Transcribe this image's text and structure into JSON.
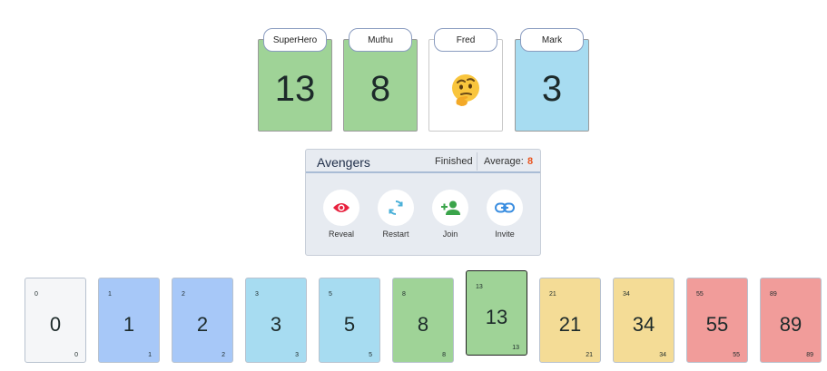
{
  "players": [
    {
      "name": "SuperHero",
      "value": "13",
      "color": "#9fd397"
    },
    {
      "name": "Muthu",
      "value": "8",
      "color": "#9fd397"
    },
    {
      "name": "Fred",
      "value": "",
      "status": "thinking-face-emoji",
      "color": "#ffffff"
    },
    {
      "name": "Mark",
      "value": "3",
      "color": "#a7dcf1"
    }
  ],
  "panel": {
    "title": "Avengers",
    "status": "Finished",
    "average_label": "Average:",
    "average_value": "8",
    "actions": [
      {
        "label": "Reveal",
        "icon": "eye-icon",
        "color": "#e8213e"
      },
      {
        "label": "Restart",
        "icon": "restart-icon",
        "color": "#4ab0d8"
      },
      {
        "label": "Join",
        "icon": "add-user-icon",
        "color": "#3aa44a"
      },
      {
        "label": "Invite",
        "icon": "link-icon",
        "color": "#3b8ee0"
      }
    ]
  },
  "deck": {
    "selected": "13",
    "cards": [
      {
        "value": "0",
        "color": "#f5f6f8"
      },
      {
        "value": "1",
        "color": "#a7c8f8"
      },
      {
        "value": "2",
        "color": "#a7c8f8"
      },
      {
        "value": "3",
        "color": "#a7dcf1"
      },
      {
        "value": "5",
        "color": "#a7dcf1"
      },
      {
        "value": "8",
        "color": "#9fd397"
      },
      {
        "value": "13",
        "color": "#9fd397"
      },
      {
        "value": "21",
        "color": "#f4dc96"
      },
      {
        "value": "34",
        "color": "#f4dc96"
      },
      {
        "value": "55",
        "color": "#f19c9a"
      },
      {
        "value": "89",
        "color": "#f19c9a"
      }
    ]
  }
}
